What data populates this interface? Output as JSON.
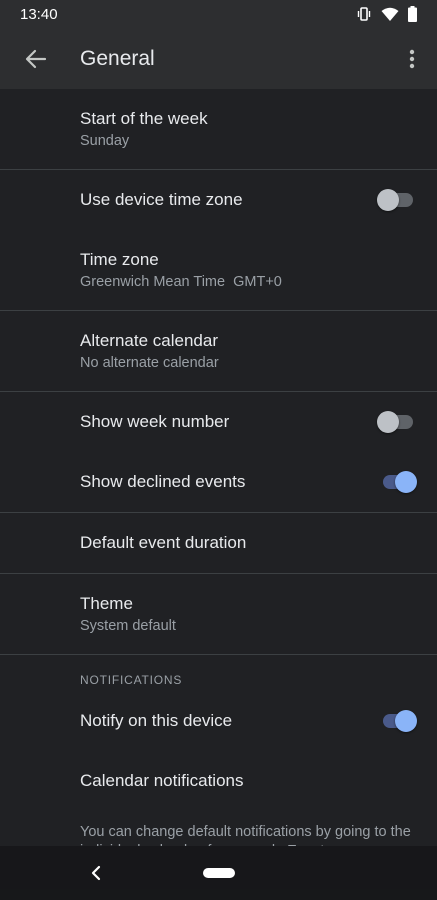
{
  "status_bar": {
    "time": "13:40"
  },
  "app_bar": {
    "title": "General"
  },
  "settings": {
    "start_of_week": {
      "title": "Start of the week",
      "value": "Sunday"
    },
    "use_device_time_zone": {
      "title": "Use device time zone",
      "enabled": false
    },
    "time_zone": {
      "title": "Time zone",
      "value": "Greenwich Mean Time  GMT+0"
    },
    "alternate_calendar": {
      "title": "Alternate calendar",
      "value": "No alternate calendar"
    },
    "show_week_number": {
      "title": "Show week number",
      "enabled": false
    },
    "show_declined_events": {
      "title": "Show declined events",
      "enabled": true
    },
    "default_event_duration": {
      "title": "Default event duration"
    },
    "theme": {
      "title": "Theme",
      "value": "System default"
    }
  },
  "notifications": {
    "header": "NOTIFICATIONS",
    "notify_on_device": {
      "title": "Notify on this device",
      "enabled": true
    },
    "calendar_notifications": {
      "title": "Calendar notifications"
    },
    "footer": "You can change default notifications by going to the individual calendar, for example Events."
  },
  "colors": {
    "background": "#202124",
    "app_bar": "#2d2e30",
    "accent": "#8ab4f8",
    "primary_text": "#e8eaed",
    "secondary_text": "#9aa0a6"
  },
  "icons": {
    "back": "arrow-left-icon",
    "more": "more-vert-icon",
    "vibrate": "vibrate-icon",
    "wifi": "wifi-icon",
    "battery": "battery-icon"
  }
}
